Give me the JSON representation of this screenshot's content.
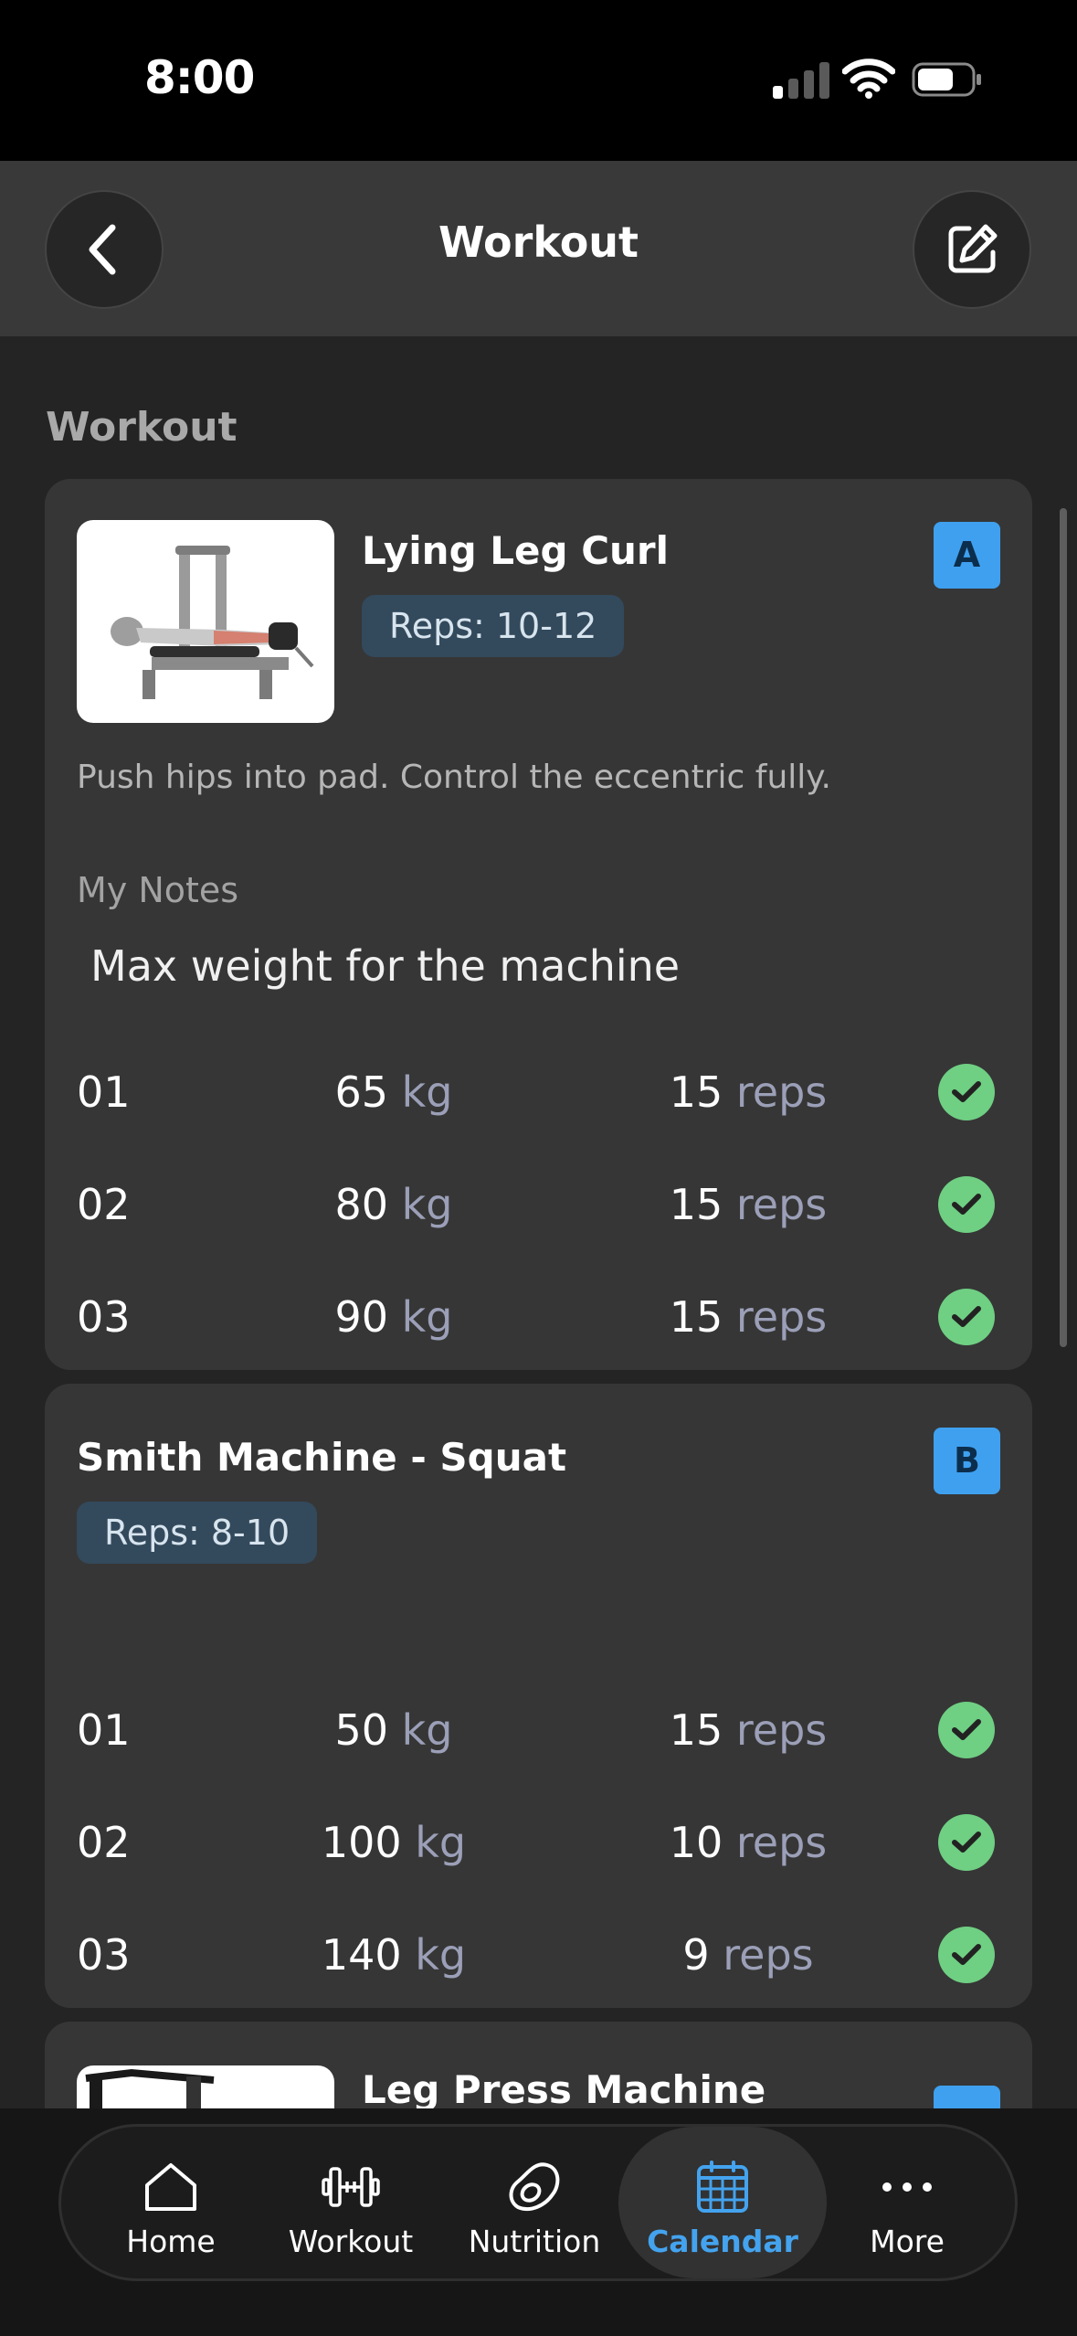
{
  "status": {
    "time": "8:00"
  },
  "header": {
    "title": "Workout"
  },
  "section_title": "Workout",
  "exercises": [
    {
      "name": "Lying Leg Curl",
      "reps_badge": "Reps: 10-12",
      "letter": "A",
      "description": "Push hips into pad. Control the eccentric fully.",
      "notes_label": "My Notes",
      "notes": "Max weight for the machine",
      "sets": [
        {
          "num": "01",
          "weight": "65",
          "weight_unit": "kg",
          "reps": "15",
          "reps_unit": "reps",
          "done": true
        },
        {
          "num": "02",
          "weight": "80",
          "weight_unit": "kg",
          "reps": "15",
          "reps_unit": "reps",
          "done": true
        },
        {
          "num": "03",
          "weight": "90",
          "weight_unit": "kg",
          "reps": "15",
          "reps_unit": "reps",
          "done": true
        }
      ]
    },
    {
      "name": "Smith Machine - Squat",
      "reps_badge": "Reps: 8-10",
      "letter": "B",
      "sets": [
        {
          "num": "01",
          "weight": "50",
          "weight_unit": "kg",
          "reps": "15",
          "reps_unit": "reps",
          "done": true
        },
        {
          "num": "02",
          "weight": "100",
          "weight_unit": "kg",
          "reps": "10",
          "reps_unit": "reps",
          "done": true
        },
        {
          "num": "03",
          "weight": "140",
          "weight_unit": "kg",
          "reps": "9",
          "reps_unit": "reps",
          "done": true
        }
      ]
    },
    {
      "name": "Leg Press Machine"
    }
  ],
  "nav": {
    "items": [
      {
        "label": "Home",
        "icon": "home-icon"
      },
      {
        "label": "Workout",
        "icon": "dumbbell-icon"
      },
      {
        "label": "Nutrition",
        "icon": "avocado-icon"
      },
      {
        "label": "Calendar",
        "icon": "calendar-icon",
        "active": true
      },
      {
        "label": "More",
        "icon": "more-icon"
      }
    ]
  },
  "colors": {
    "accent": "#44a3ee",
    "check": "#6fcf83",
    "badge": "#3fa0ef"
  }
}
